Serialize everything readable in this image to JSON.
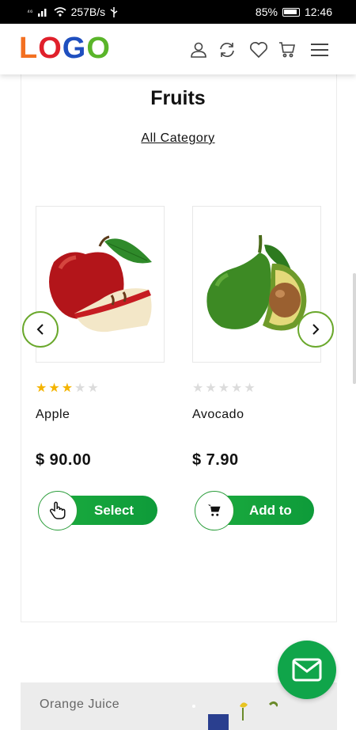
{
  "status_bar": {
    "signal": "⁴⁶",
    "speed": "257B/s",
    "battery": "85%",
    "time": "12:46"
  },
  "header": {
    "logo": [
      "L",
      "O",
      "G",
      "O"
    ],
    "icons": [
      "user-icon",
      "refresh-icon",
      "heart-icon",
      "cart-icon",
      "menu-icon"
    ]
  },
  "section": {
    "title": "Fruits",
    "category_link": "All Category"
  },
  "products": [
    {
      "name": "Apple",
      "price": "$ 90.00",
      "rating": 3,
      "max_rating": 5,
      "button_label": "Select",
      "button_icon": "hand-pointer-icon"
    },
    {
      "name": "Avocado",
      "price": "$ 7.90",
      "rating": 0,
      "max_rating": 5,
      "button_label": "Add to",
      "button_icon": "cart-icon"
    }
  ],
  "banner": {
    "text": "Orange Juice"
  },
  "colors": {
    "primary_green": "#10a54a",
    "star": "#f4b400",
    "arrow_border": "#6aa82c"
  }
}
